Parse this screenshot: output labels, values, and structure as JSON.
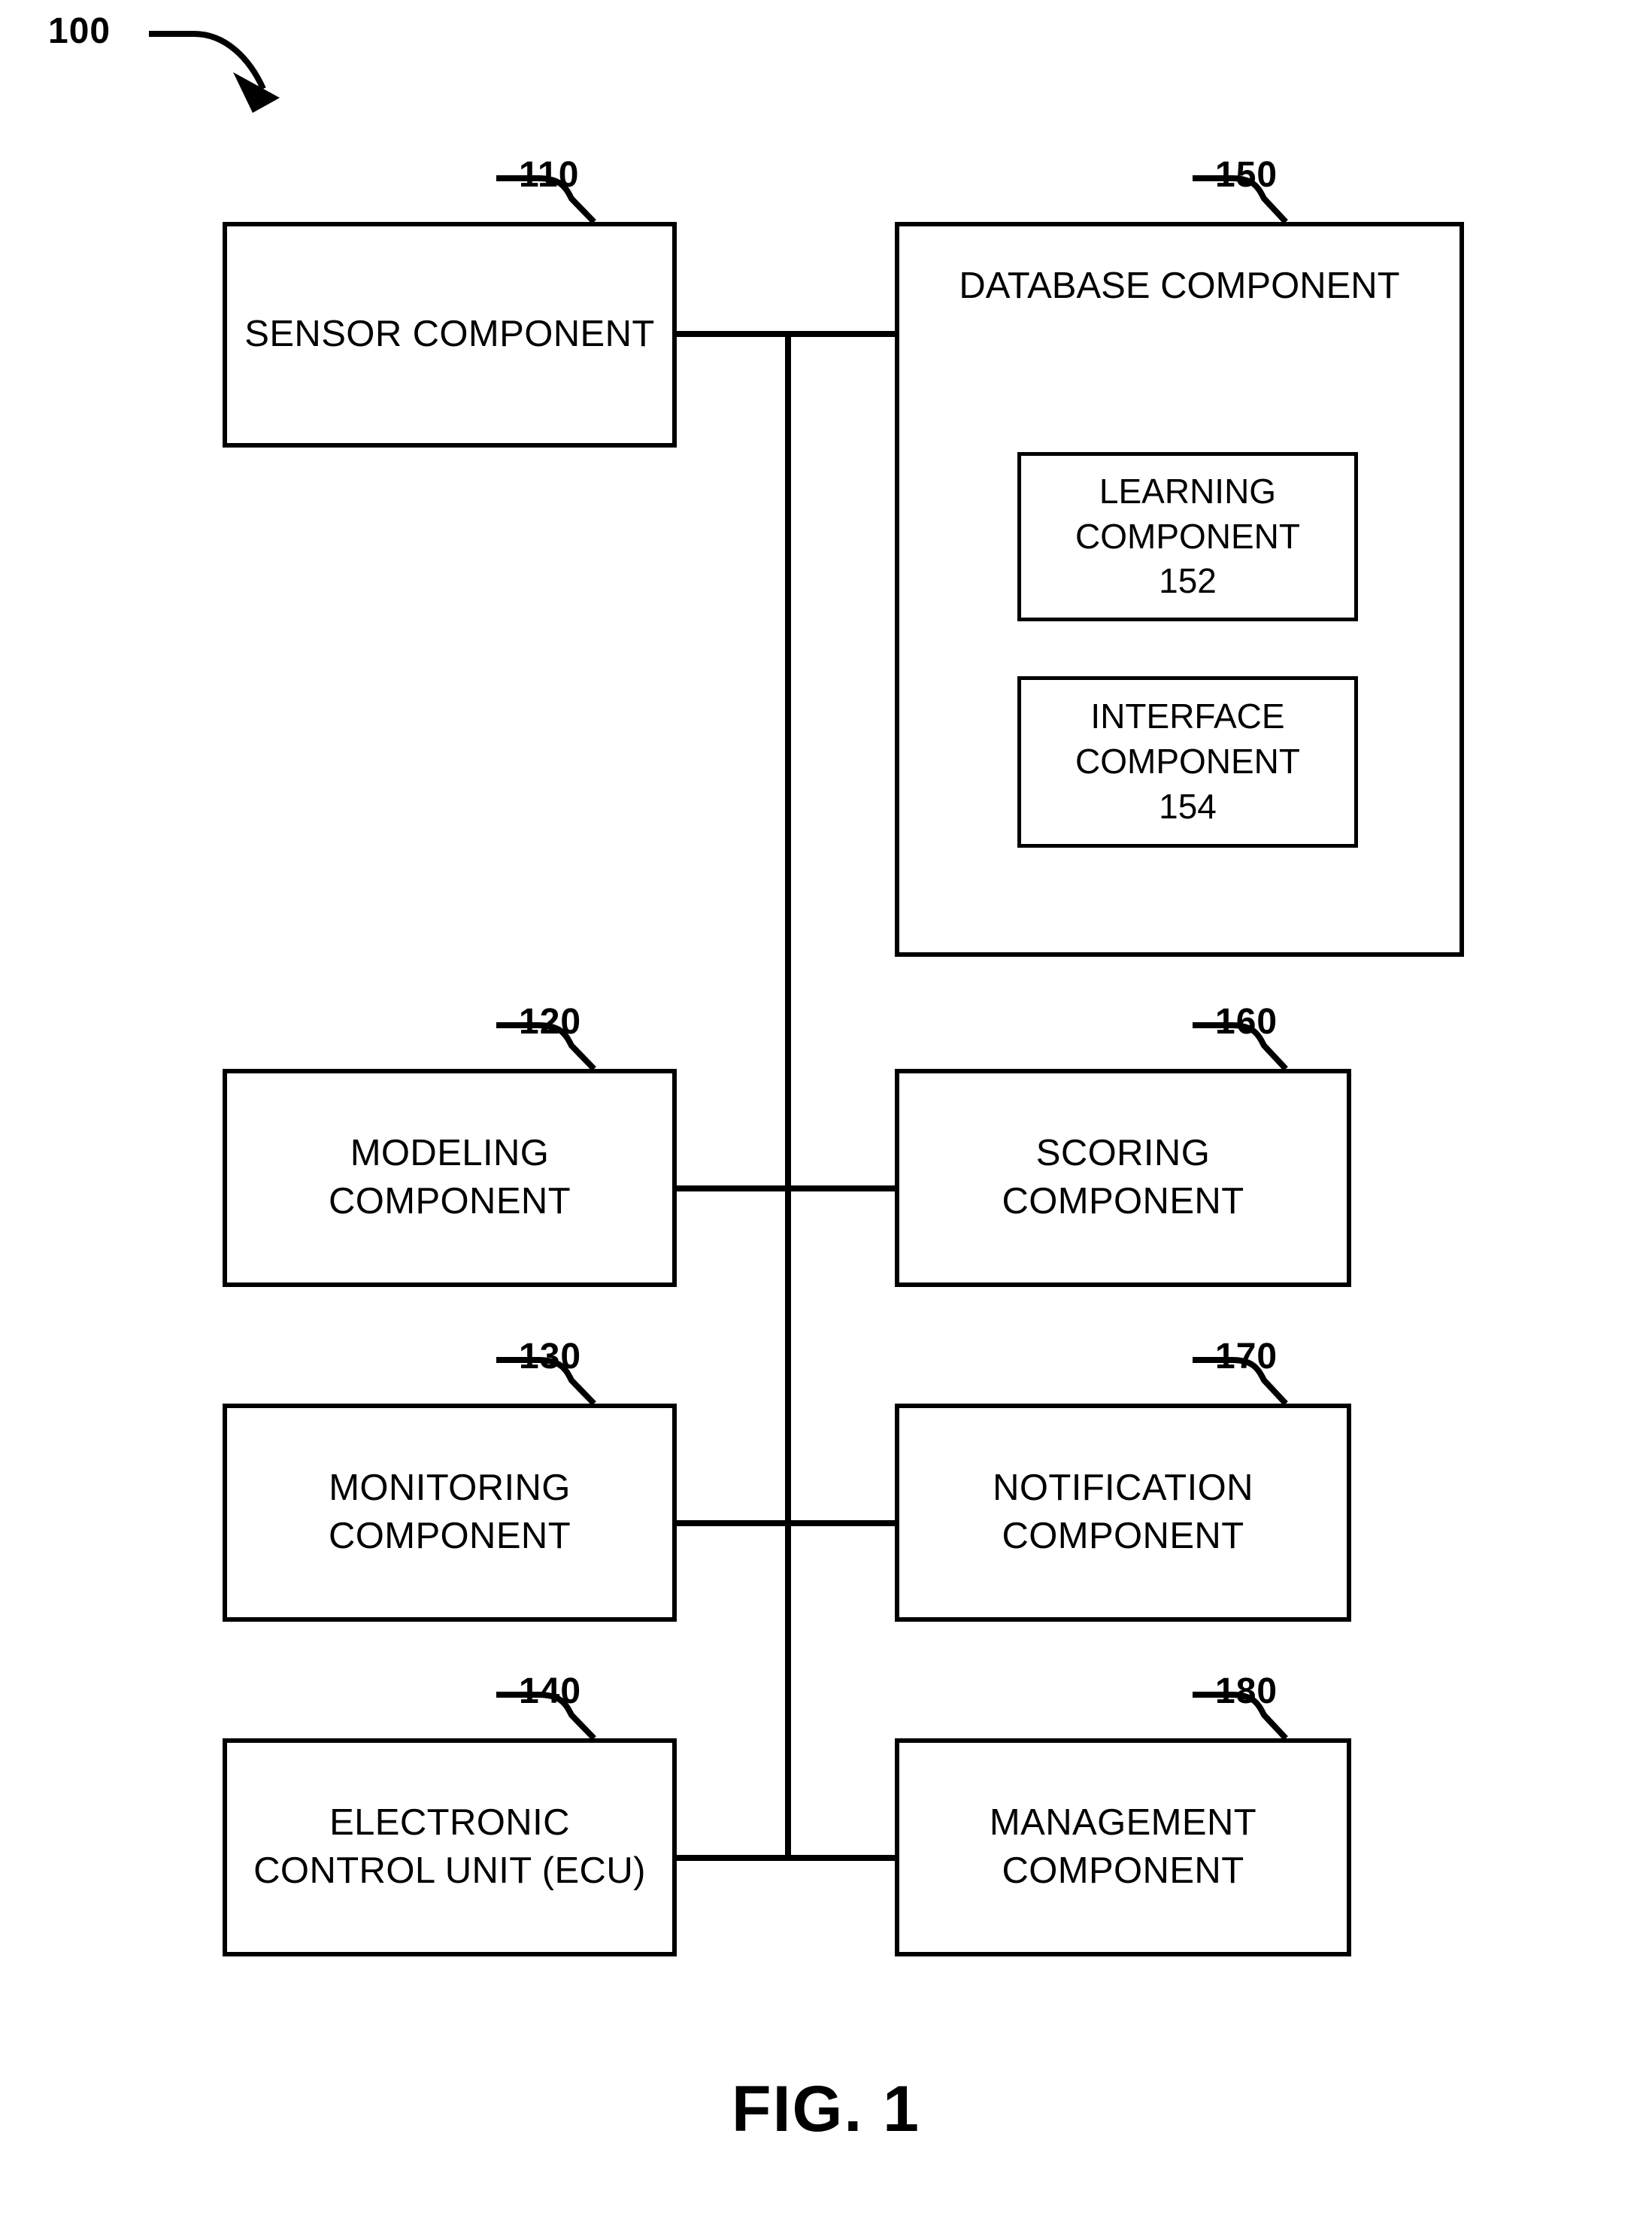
{
  "figure": {
    "caption": "FIG. 1",
    "system_reference": "100"
  },
  "boxes": [
    {
      "id": "sensor-component",
      "label": "SENSOR COMPONENT",
      "ref": "110"
    },
    {
      "id": "database-component",
      "label": "DATABASE COMPONENT",
      "ref": "150"
    },
    {
      "id": "learning-component",
      "label": "LEARNING\nCOMPONENT\n152",
      "ref": "152"
    },
    {
      "id": "interface-component",
      "label": "INTERFACE\nCOMPONENT\n154",
      "ref": "154"
    },
    {
      "id": "modeling-component",
      "label": "MODELING\nCOMPONENT",
      "ref": "120"
    },
    {
      "id": "scoring-component",
      "label": "SCORING\nCOMPONENT",
      "ref": "160"
    },
    {
      "id": "monitoring-component",
      "label": "MONITORING\nCOMPONENT",
      "ref": "130"
    },
    {
      "id": "notification-component",
      "label": "NOTIFICATION\nCOMPONENT",
      "ref": "170"
    },
    {
      "id": "ecu-component",
      "label": "ELECTRONIC\nCONTROL UNIT (ECU)",
      "ref": "140"
    },
    {
      "id": "management-component",
      "label": "MANAGEMENT\nCOMPONENT",
      "ref": "180"
    }
  ],
  "colors": {
    "stroke": "#000000",
    "background": "#ffffff"
  }
}
